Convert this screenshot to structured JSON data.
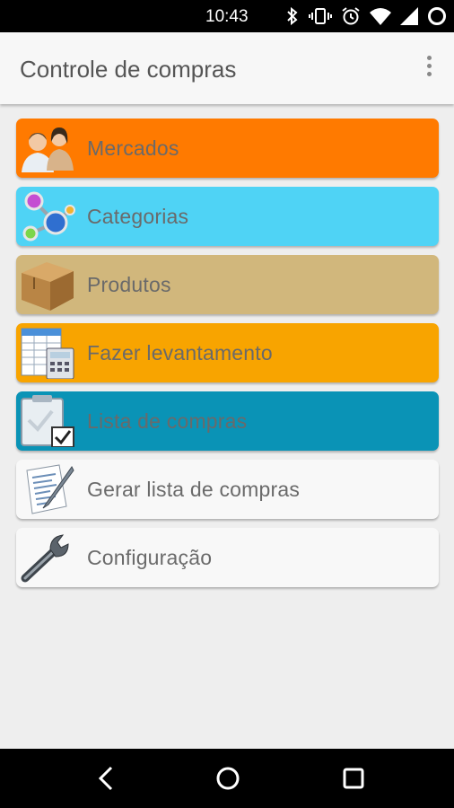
{
  "status_bar": {
    "time": "10:43"
  },
  "app_bar": {
    "title": "Controle de compras"
  },
  "menu": [
    {
      "label": "Mercados",
      "color": "#ff7a00",
      "icon": "people-icon"
    },
    {
      "label": "Categorias",
      "color": "#4fd3f5",
      "icon": "network-icon"
    },
    {
      "label": "Produtos",
      "color": "#d1b77c",
      "icon": "box-icon"
    },
    {
      "label": "Fazer levantamento",
      "color": "#f8a400",
      "icon": "spreadsheet-calculator-icon"
    },
    {
      "label": "Lista de compras",
      "color": "#0a93b6",
      "icon": "clipboard-check-icon"
    },
    {
      "label": "Gerar lista de compras",
      "color": "#f8f8f8",
      "icon": "document-pen-icon"
    },
    {
      "label": "Configuração",
      "color": "#f8f8f8",
      "icon": "wrench-icon"
    }
  ]
}
